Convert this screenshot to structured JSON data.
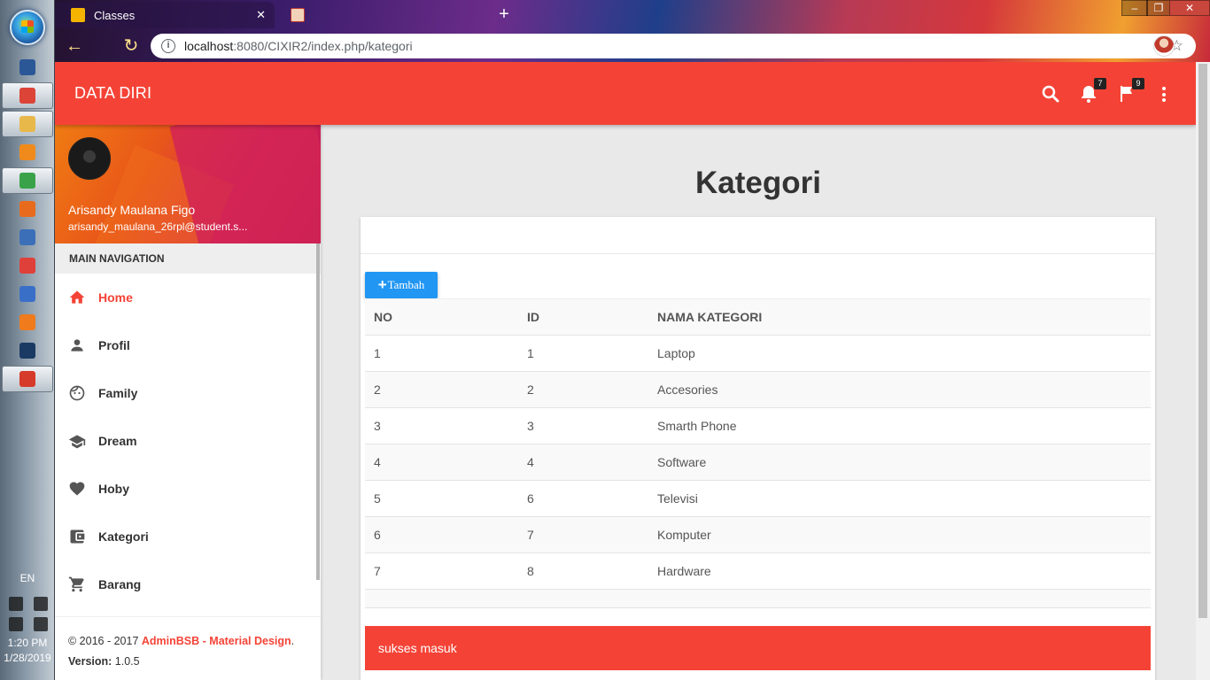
{
  "taskbar": {
    "language": "EN",
    "time": "1:20 PM",
    "date": "1/28/2019",
    "icons": [
      {
        "name": "word-icon",
        "color": "#2b5797",
        "active": false
      },
      {
        "name": "chrome-icon",
        "color": "#db4437",
        "active": true
      },
      {
        "name": "file-explorer-icon",
        "color": "#e8b84a",
        "active": true
      },
      {
        "name": "media-player-icon",
        "color": "#f08a1c",
        "active": false
      },
      {
        "name": "atom-icon",
        "color": "#3aa34a",
        "active": true
      },
      {
        "name": "xampp-icon",
        "color": "#e86a1c",
        "active": false
      },
      {
        "name": "virtualbox-icon",
        "color": "#3b6fb8",
        "active": false
      },
      {
        "name": "git-icon",
        "color": "#e0403a",
        "active": false
      },
      {
        "name": "sublime-icon",
        "color": "#3a6fc8",
        "active": false
      },
      {
        "name": "firefox-icon",
        "color": "#f07b1c",
        "active": false
      },
      {
        "name": "steam-icon",
        "color": "#1b3a63",
        "active": false
      },
      {
        "name": "filezilla-icon",
        "color": "#d63a2a",
        "active": true
      }
    ]
  },
  "browser": {
    "tab_title": "Classes",
    "url_host": "localhost",
    "url_path": ":8080/CIXIR2/index.php/kategori"
  },
  "app": {
    "brand": "DATA DIRI",
    "notifications_count": "7",
    "flags_count": "9"
  },
  "colors": {
    "primary": "#f44336",
    "button": "#2196f3"
  },
  "user": {
    "name": "Arisandy Maulana Figo",
    "email": "arisandy_maulana_26rpl@student.s..."
  },
  "sidebar": {
    "header": "MAIN NAVIGATION",
    "items": [
      {
        "label": "Home",
        "icon": "home-icon"
      },
      {
        "label": "Profil",
        "icon": "person-icon"
      },
      {
        "label": "Family",
        "icon": "face-icon"
      },
      {
        "label": "Dream",
        "icon": "school-icon"
      },
      {
        "label": "Hoby",
        "icon": "heart-icon"
      },
      {
        "label": "Kategori",
        "icon": "wallet-icon"
      },
      {
        "label": "Barang",
        "icon": "cart-icon"
      }
    ]
  },
  "footer": {
    "copyright": "© 2016 - 2017 ",
    "brand_link": "AdminBSB - Material Design",
    "dot": ".",
    "version_label": "Version:",
    "version": " 1.0.5"
  },
  "page": {
    "title": "Kategori",
    "add_button": "Tambah",
    "columns": [
      "NO",
      "ID",
      "NAMA KATEGORI"
    ],
    "rows": [
      [
        "1",
        "1",
        "Laptop"
      ],
      [
        "2",
        "2",
        "Accesories"
      ],
      [
        "3",
        "3",
        "Smarth Phone"
      ],
      [
        "4",
        "4",
        "Software"
      ],
      [
        "5",
        "6",
        "Televisi"
      ],
      [
        "6",
        "7",
        "Komputer"
      ],
      [
        "7",
        "8",
        "Hardware"
      ]
    ],
    "alert": "sukses masuk"
  }
}
